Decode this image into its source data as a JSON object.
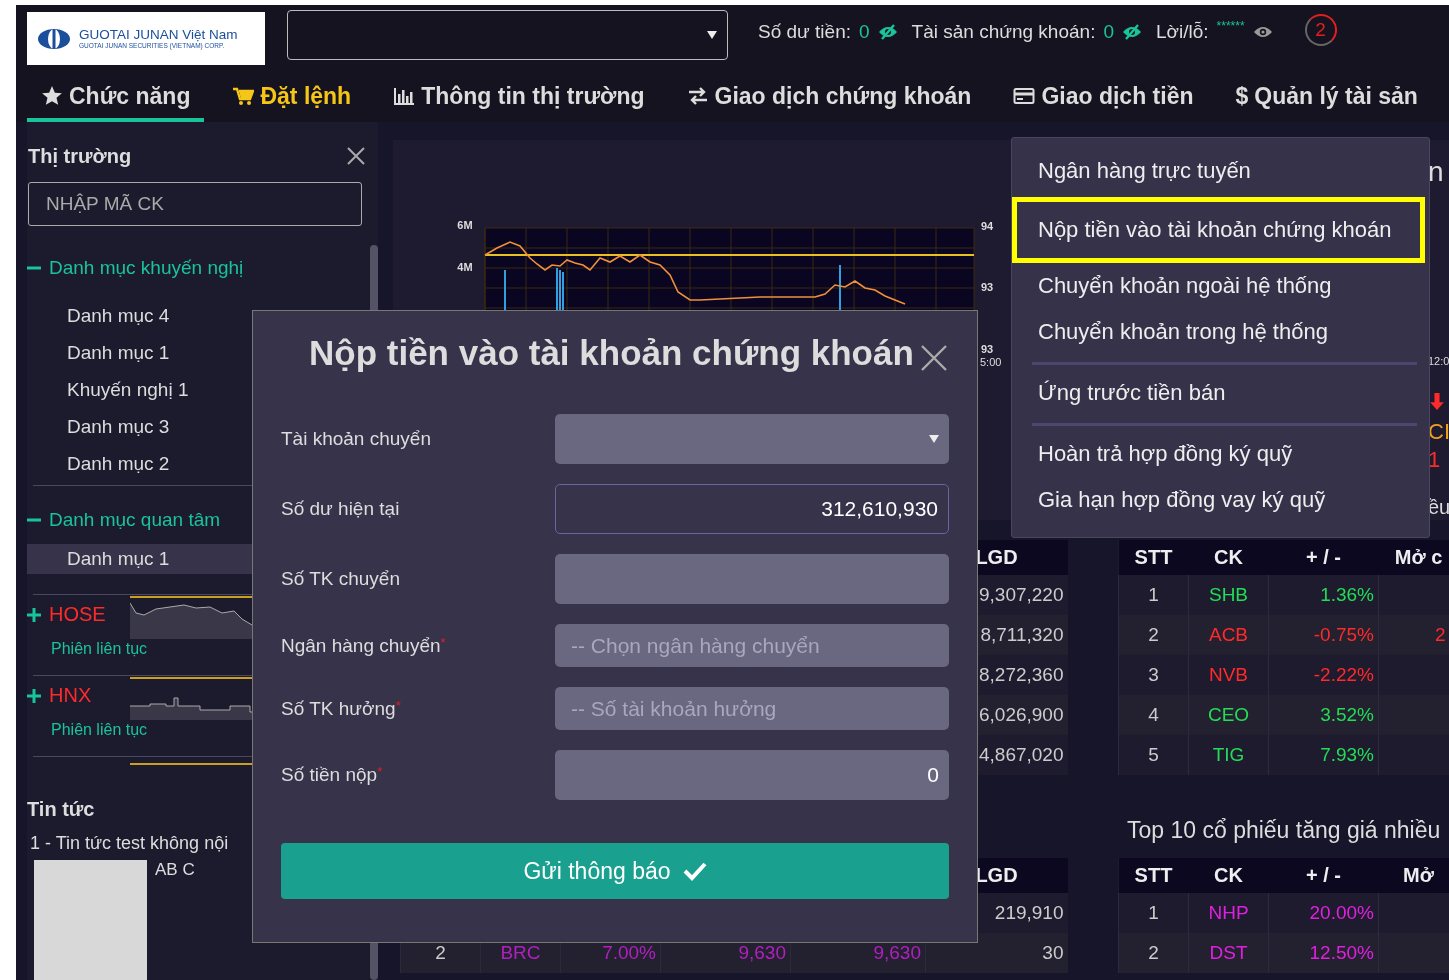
{
  "header": {
    "logo": {
      "name": "GUOTAI JUNAN Việt Nam",
      "subtitle": "GUOTAI JUNAN SECURITIES (VIETNAM) CORP."
    },
    "balances": [
      {
        "label": "Số dư tiền:",
        "value": "0",
        "visible": true
      },
      {
        "label": "Tài sản chứng khoán:",
        "value": "0",
        "visible": true
      },
      {
        "label": "Lời/lỗ:",
        "value": "******",
        "visible": false
      }
    ],
    "notifications": {
      "count": "2"
    }
  },
  "nav": {
    "tabs": [
      {
        "label": "Chức năng",
        "kind": "star",
        "selected": true
      },
      {
        "label": "Đặt lệnh",
        "kind": "cart",
        "selected": false,
        "color": "#f5c518"
      },
      {
        "label": "Thông tin thị trường",
        "kind": "chart",
        "selected": false
      },
      {
        "label": "Giao dịch chứng khoán",
        "kind": "exchange",
        "selected": false
      },
      {
        "label": "Giao dịch tiền",
        "kind": "card",
        "selected": false
      },
      {
        "label": "Quản lý tài sản",
        "kind": "glyph",
        "glyph": "$",
        "selected": false
      }
    ]
  },
  "sidebar": {
    "title": "Thị trường",
    "search": {
      "placeholder": "NHẬP MÃ CK"
    },
    "groups": [
      {
        "label": "Danh mục khuyến nghị",
        "expanded": true,
        "children": [
          {
            "label": "Danh mục 4",
            "selected": false
          },
          {
            "label": "Danh mục 1",
            "selected": false
          },
          {
            "label": "Khuyến nghị 1",
            "selected": false
          },
          {
            "label": "Danh mục 3",
            "selected": false
          },
          {
            "label": "Danh mục 2",
            "selected": false
          }
        ]
      },
      {
        "label": "Danh mục quan tâm",
        "expanded": true,
        "children": [
          {
            "label": "Danh mục 1",
            "selected": true
          }
        ]
      }
    ],
    "indices": [
      {
        "name": "HOSE",
        "session": "Phiên liên tục",
        "expanded": false,
        "kind": "wave"
      },
      {
        "name": "HNX",
        "session": "Phiên liên tục",
        "expanded": false,
        "kind": "flat"
      }
    ],
    "news": {
      "title": "Tin tức",
      "items": [
        {
          "title": "1 - Tin tức test không nội",
          "summary": "AB C"
        }
      ]
    }
  },
  "chart": {
    "left_ticks": [
      "6M",
      "4M"
    ],
    "right_ticks": [
      "94",
      "93",
      "93"
    ],
    "time_label": "5:00"
  },
  "right_panel": {
    "title_fragment": "n",
    "time_label": "12:0",
    "code_fragment": "CI",
    "value_fragment": "1",
    "text_fragment": "ều"
  },
  "left_tables": [
    {
      "last_column": "LGD",
      "rows": [
        {
          "volume": "9,307,220"
        },
        {
          "volume": "8,711,320"
        },
        {
          "volume": "8,272,360"
        },
        {
          "volume": "6,026,900"
        },
        {
          "volume": "4,867,020"
        }
      ]
    },
    {
      "last_column": "LGD",
      "rows": [
        {
          "volume": "219,910"
        },
        {
          "stt": "2",
          "ck": "BRC",
          "change": "7.00%",
          "price_1": "9,630",
          "price_2": "9,630",
          "volume": "30",
          "color": "#b020c0"
        }
      ]
    }
  ],
  "right_tables": [
    {
      "columns": [
        "STT",
        "CK",
        "+ / -",
        "Mở c"
      ],
      "rows": [
        {
          "stt": "1",
          "ck": "SHB",
          "change": "1.36%",
          "color": "#22dd55"
        },
        {
          "stt": "2",
          "ck": "ACB",
          "change": "-0.75%",
          "open": "2",
          "color": "#ff2a2a"
        },
        {
          "stt": "3",
          "ck": "NVB",
          "change": "-2.22%",
          "color": "#ff2a2a"
        },
        {
          "stt": "4",
          "ck": "CEO",
          "change": "3.52%",
          "color": "#22dd55"
        },
        {
          "stt": "5",
          "ck": "TIG",
          "change": "7.93%",
          "color": "#22dd55"
        }
      ]
    },
    {
      "title": "Top 10 cổ phiếu tăng giá nhiều",
      "columns": [
        "STT",
        "CK",
        "+ / -",
        "Mở"
      ],
      "rows": [
        {
          "stt": "1",
          "ck": "NHP",
          "change": "20.00%",
          "color": "#e020e0"
        },
        {
          "stt": "2",
          "ck": "DST",
          "change": "12.50%",
          "color": "#e020e0"
        }
      ]
    }
  ],
  "modal": {
    "title": "Nộp tiền vào tài khoản chứng khoán",
    "fields": [
      {
        "label": "Tài khoản chuyển",
        "kind": "select"
      },
      {
        "label": "Số dư hiện tại",
        "kind": "readonly",
        "value": "312,610,930"
      },
      {
        "label": "Số TK chuyển",
        "kind": "text"
      },
      {
        "label": "Ngân hàng chuyển",
        "required_mark": "*",
        "kind": "text",
        "placeholder": "-- Chọn ngân hàng chuyển"
      },
      {
        "label": "Số TK hưởng",
        "required_mark": "*",
        "kind": "text",
        "placeholder": "-- Số tài khoản hưởng"
      },
      {
        "label": "Số tiền nộp",
        "required_mark": "*",
        "kind": "number",
        "value": "0"
      }
    ],
    "submit": "Gửi thông báo"
  },
  "menu": {
    "items": [
      {
        "kind": "item",
        "label": "Ngân hàng trực tuyến",
        "selected": false
      },
      {
        "kind": "item",
        "label": "Nộp tiền vào tài khoản chứng khoán",
        "selected": true
      },
      {
        "kind": "item",
        "label": "Chuyển khoản ngoài hệ thống",
        "selected": false
      },
      {
        "kind": "item",
        "label": "Chuyển khoản trong hệ thống",
        "selected": false
      },
      {
        "kind": "divider"
      },
      {
        "kind": "item",
        "label": "Ứng trước tiền bán",
        "selected": false
      },
      {
        "kind": "divider"
      },
      {
        "kind": "item",
        "label": "Hoàn trả hợp đồng ký quỹ",
        "selected": false
      },
      {
        "kind": "item",
        "label": "Gia hạn hợp đồng vay ký quỹ",
        "selected": false
      }
    ]
  }
}
